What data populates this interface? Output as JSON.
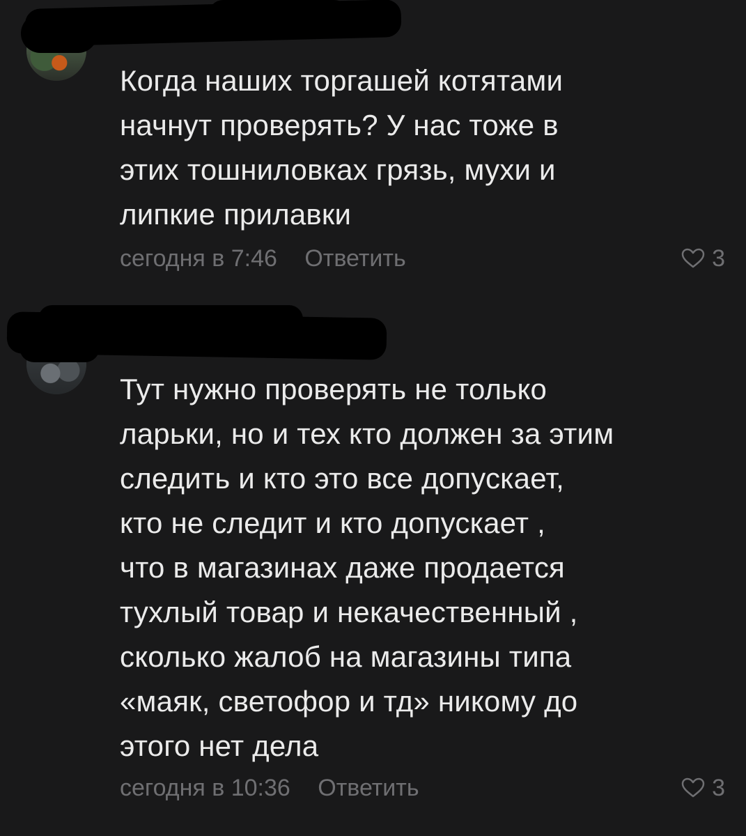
{
  "comments": [
    {
      "text_lines": [
        "Когда наших торгашей котятами",
        "начнут проверять? У нас тоже в",
        "этих тошниловках грязь, мухи и",
        "липкие прилавки"
      ],
      "time": "сегодня в 7:46",
      "reply_label": "Ответить",
      "likes": "3"
    },
    {
      "text_lines": [
        "Тут нужно проверять не только",
        "ларьки, но и тех кто должен за этим",
        "следить и кто это все допускает,",
        "кто не следит и кто допускает ,",
        "что в магазинах даже продается",
        "тухлый товар и некачественный ,",
        "сколько жалоб на магазины типа",
        "«маяк, светофор и тд» никому до",
        "этого нет дела"
      ],
      "time": "сегодня в 10:36",
      "reply_label": "Ответить",
      "likes": "3"
    }
  ],
  "colors": {
    "background": "#19191a",
    "text": "#ebebeb",
    "meta": "#6f6f72",
    "redaction": "#000000"
  },
  "icons": [
    "heart-icon"
  ]
}
